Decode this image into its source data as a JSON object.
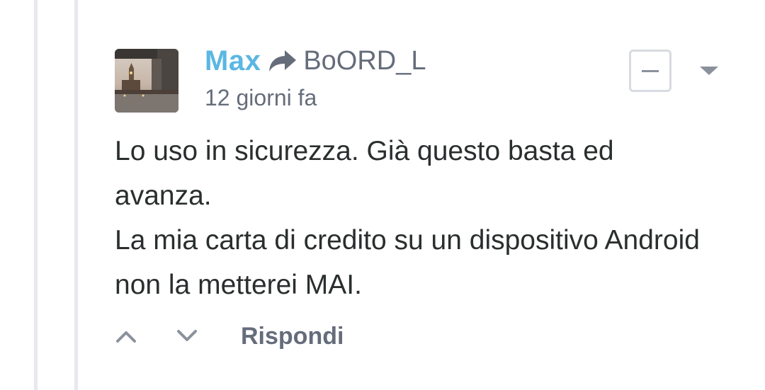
{
  "comment": {
    "author": "Max",
    "reply_to": "BoORD_L",
    "timestamp": "12 giorni fa",
    "body": [
      "Lo uso in sicurezza. Già questo basta ed avanza.",
      "La mia carta di credito su un dispositivo Android non la metterei MAI."
    ],
    "actions": {
      "reply_label": "Rispondi"
    }
  },
  "colors": {
    "author": "#5bb7e3",
    "meta": "#656c7a",
    "body": "#2a2e2e",
    "thread_line": "#e7e9ee"
  },
  "icons": {
    "reply_to": "reply-arrow-icon",
    "collapse": "minus-icon",
    "menu": "caret-down-icon",
    "upvote": "chevron-up-icon",
    "downvote": "chevron-down-icon"
  }
}
